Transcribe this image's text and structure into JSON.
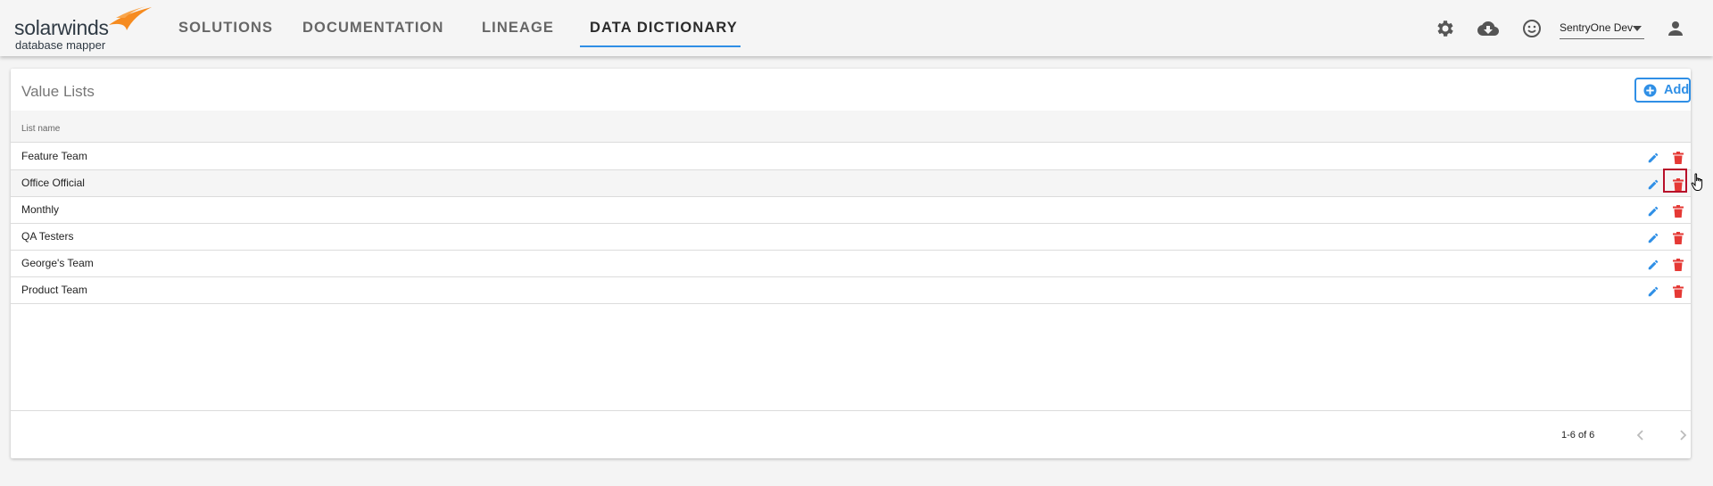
{
  "app": {
    "logo_main": "solarwinds",
    "logo_sub": "database mapper"
  },
  "nav": {
    "items": [
      {
        "label": "SOLUTIONS",
        "active": false
      },
      {
        "label": "DOCUMENTATION",
        "active": false
      },
      {
        "label": "LINEAGE",
        "active": false
      },
      {
        "label": "DATA DICTIONARY",
        "active": true
      }
    ]
  },
  "topbar": {
    "icons": [
      "gear-icon",
      "cloud-download-icon",
      "smiley-icon",
      "account-icon"
    ],
    "user_menu_label": "SentryOne Dev"
  },
  "page": {
    "title": "Value Lists",
    "add_label": "Add"
  },
  "table": {
    "column_header": "List name",
    "rows": [
      {
        "name": "Feature Team"
      },
      {
        "name": "Office Official"
      },
      {
        "name": "Monthly"
      },
      {
        "name": "QA Testers"
      },
      {
        "name": "George's Team"
      },
      {
        "name": "Product Team"
      }
    ]
  },
  "pagination": {
    "range_text": "1-6 of 6"
  },
  "colors": {
    "accent": "#2f8fe6",
    "delete": "#e53935",
    "focus": "#b8102a",
    "logo_orange": "#f68b1f"
  }
}
